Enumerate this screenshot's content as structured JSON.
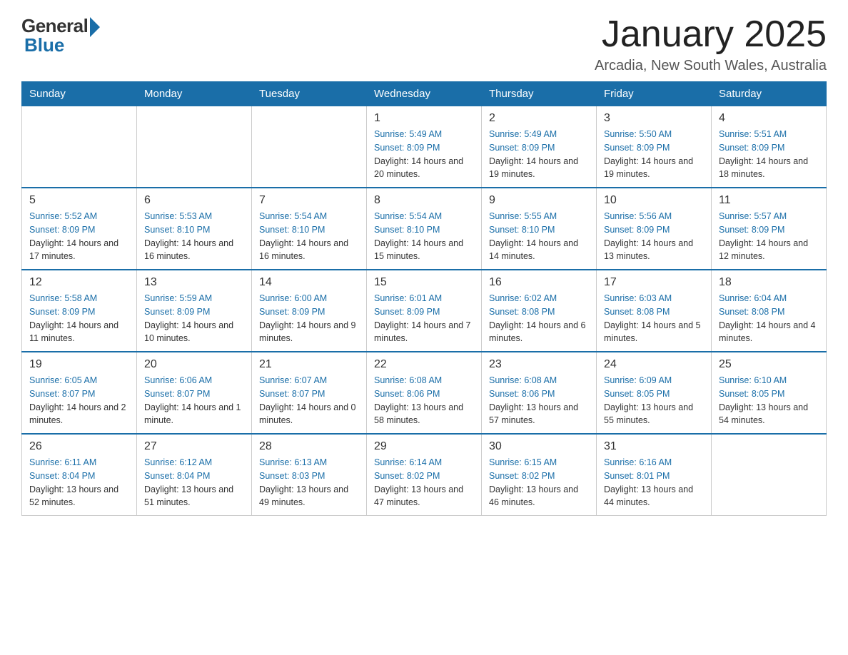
{
  "header": {
    "logo_general": "General",
    "logo_blue": "Blue",
    "title": "January 2025",
    "subtitle": "Arcadia, New South Wales, Australia"
  },
  "days_of_week": [
    "Sunday",
    "Monday",
    "Tuesday",
    "Wednesday",
    "Thursday",
    "Friday",
    "Saturday"
  ],
  "weeks": [
    {
      "days": [
        {
          "number": "",
          "info": ""
        },
        {
          "number": "",
          "info": ""
        },
        {
          "number": "",
          "info": ""
        },
        {
          "number": "1",
          "sunrise": "Sunrise: 5:49 AM",
          "sunset": "Sunset: 8:09 PM",
          "daylight": "Daylight: 14 hours and 20 minutes."
        },
        {
          "number": "2",
          "sunrise": "Sunrise: 5:49 AM",
          "sunset": "Sunset: 8:09 PM",
          "daylight": "Daylight: 14 hours and 19 minutes."
        },
        {
          "number": "3",
          "sunrise": "Sunrise: 5:50 AM",
          "sunset": "Sunset: 8:09 PM",
          "daylight": "Daylight: 14 hours and 19 minutes."
        },
        {
          "number": "4",
          "sunrise": "Sunrise: 5:51 AM",
          "sunset": "Sunset: 8:09 PM",
          "daylight": "Daylight: 14 hours and 18 minutes."
        }
      ]
    },
    {
      "days": [
        {
          "number": "5",
          "sunrise": "Sunrise: 5:52 AM",
          "sunset": "Sunset: 8:09 PM",
          "daylight": "Daylight: 14 hours and 17 minutes."
        },
        {
          "number": "6",
          "sunrise": "Sunrise: 5:53 AM",
          "sunset": "Sunset: 8:10 PM",
          "daylight": "Daylight: 14 hours and 16 minutes."
        },
        {
          "number": "7",
          "sunrise": "Sunrise: 5:54 AM",
          "sunset": "Sunset: 8:10 PM",
          "daylight": "Daylight: 14 hours and 16 minutes."
        },
        {
          "number": "8",
          "sunrise": "Sunrise: 5:54 AM",
          "sunset": "Sunset: 8:10 PM",
          "daylight": "Daylight: 14 hours and 15 minutes."
        },
        {
          "number": "9",
          "sunrise": "Sunrise: 5:55 AM",
          "sunset": "Sunset: 8:10 PM",
          "daylight": "Daylight: 14 hours and 14 minutes."
        },
        {
          "number": "10",
          "sunrise": "Sunrise: 5:56 AM",
          "sunset": "Sunset: 8:09 PM",
          "daylight": "Daylight: 14 hours and 13 minutes."
        },
        {
          "number": "11",
          "sunrise": "Sunrise: 5:57 AM",
          "sunset": "Sunset: 8:09 PM",
          "daylight": "Daylight: 14 hours and 12 minutes."
        }
      ]
    },
    {
      "days": [
        {
          "number": "12",
          "sunrise": "Sunrise: 5:58 AM",
          "sunset": "Sunset: 8:09 PM",
          "daylight": "Daylight: 14 hours and 11 minutes."
        },
        {
          "number": "13",
          "sunrise": "Sunrise: 5:59 AM",
          "sunset": "Sunset: 8:09 PM",
          "daylight": "Daylight: 14 hours and 10 minutes."
        },
        {
          "number": "14",
          "sunrise": "Sunrise: 6:00 AM",
          "sunset": "Sunset: 8:09 PM",
          "daylight": "Daylight: 14 hours and 9 minutes."
        },
        {
          "number": "15",
          "sunrise": "Sunrise: 6:01 AM",
          "sunset": "Sunset: 8:09 PM",
          "daylight": "Daylight: 14 hours and 7 minutes."
        },
        {
          "number": "16",
          "sunrise": "Sunrise: 6:02 AM",
          "sunset": "Sunset: 8:08 PM",
          "daylight": "Daylight: 14 hours and 6 minutes."
        },
        {
          "number": "17",
          "sunrise": "Sunrise: 6:03 AM",
          "sunset": "Sunset: 8:08 PM",
          "daylight": "Daylight: 14 hours and 5 minutes."
        },
        {
          "number": "18",
          "sunrise": "Sunrise: 6:04 AM",
          "sunset": "Sunset: 8:08 PM",
          "daylight": "Daylight: 14 hours and 4 minutes."
        }
      ]
    },
    {
      "days": [
        {
          "number": "19",
          "sunrise": "Sunrise: 6:05 AM",
          "sunset": "Sunset: 8:07 PM",
          "daylight": "Daylight: 14 hours and 2 minutes."
        },
        {
          "number": "20",
          "sunrise": "Sunrise: 6:06 AM",
          "sunset": "Sunset: 8:07 PM",
          "daylight": "Daylight: 14 hours and 1 minute."
        },
        {
          "number": "21",
          "sunrise": "Sunrise: 6:07 AM",
          "sunset": "Sunset: 8:07 PM",
          "daylight": "Daylight: 14 hours and 0 minutes."
        },
        {
          "number": "22",
          "sunrise": "Sunrise: 6:08 AM",
          "sunset": "Sunset: 8:06 PM",
          "daylight": "Daylight: 13 hours and 58 minutes."
        },
        {
          "number": "23",
          "sunrise": "Sunrise: 6:08 AM",
          "sunset": "Sunset: 8:06 PM",
          "daylight": "Daylight: 13 hours and 57 minutes."
        },
        {
          "number": "24",
          "sunrise": "Sunrise: 6:09 AM",
          "sunset": "Sunset: 8:05 PM",
          "daylight": "Daylight: 13 hours and 55 minutes."
        },
        {
          "number": "25",
          "sunrise": "Sunrise: 6:10 AM",
          "sunset": "Sunset: 8:05 PM",
          "daylight": "Daylight: 13 hours and 54 minutes."
        }
      ]
    },
    {
      "days": [
        {
          "number": "26",
          "sunrise": "Sunrise: 6:11 AM",
          "sunset": "Sunset: 8:04 PM",
          "daylight": "Daylight: 13 hours and 52 minutes."
        },
        {
          "number": "27",
          "sunrise": "Sunrise: 6:12 AM",
          "sunset": "Sunset: 8:04 PM",
          "daylight": "Daylight: 13 hours and 51 minutes."
        },
        {
          "number": "28",
          "sunrise": "Sunrise: 6:13 AM",
          "sunset": "Sunset: 8:03 PM",
          "daylight": "Daylight: 13 hours and 49 minutes."
        },
        {
          "number": "29",
          "sunrise": "Sunrise: 6:14 AM",
          "sunset": "Sunset: 8:02 PM",
          "daylight": "Daylight: 13 hours and 47 minutes."
        },
        {
          "number": "30",
          "sunrise": "Sunrise: 6:15 AM",
          "sunset": "Sunset: 8:02 PM",
          "daylight": "Daylight: 13 hours and 46 minutes."
        },
        {
          "number": "31",
          "sunrise": "Sunrise: 6:16 AM",
          "sunset": "Sunset: 8:01 PM",
          "daylight": "Daylight: 13 hours and 44 minutes."
        },
        {
          "number": "",
          "info": ""
        }
      ]
    }
  ]
}
